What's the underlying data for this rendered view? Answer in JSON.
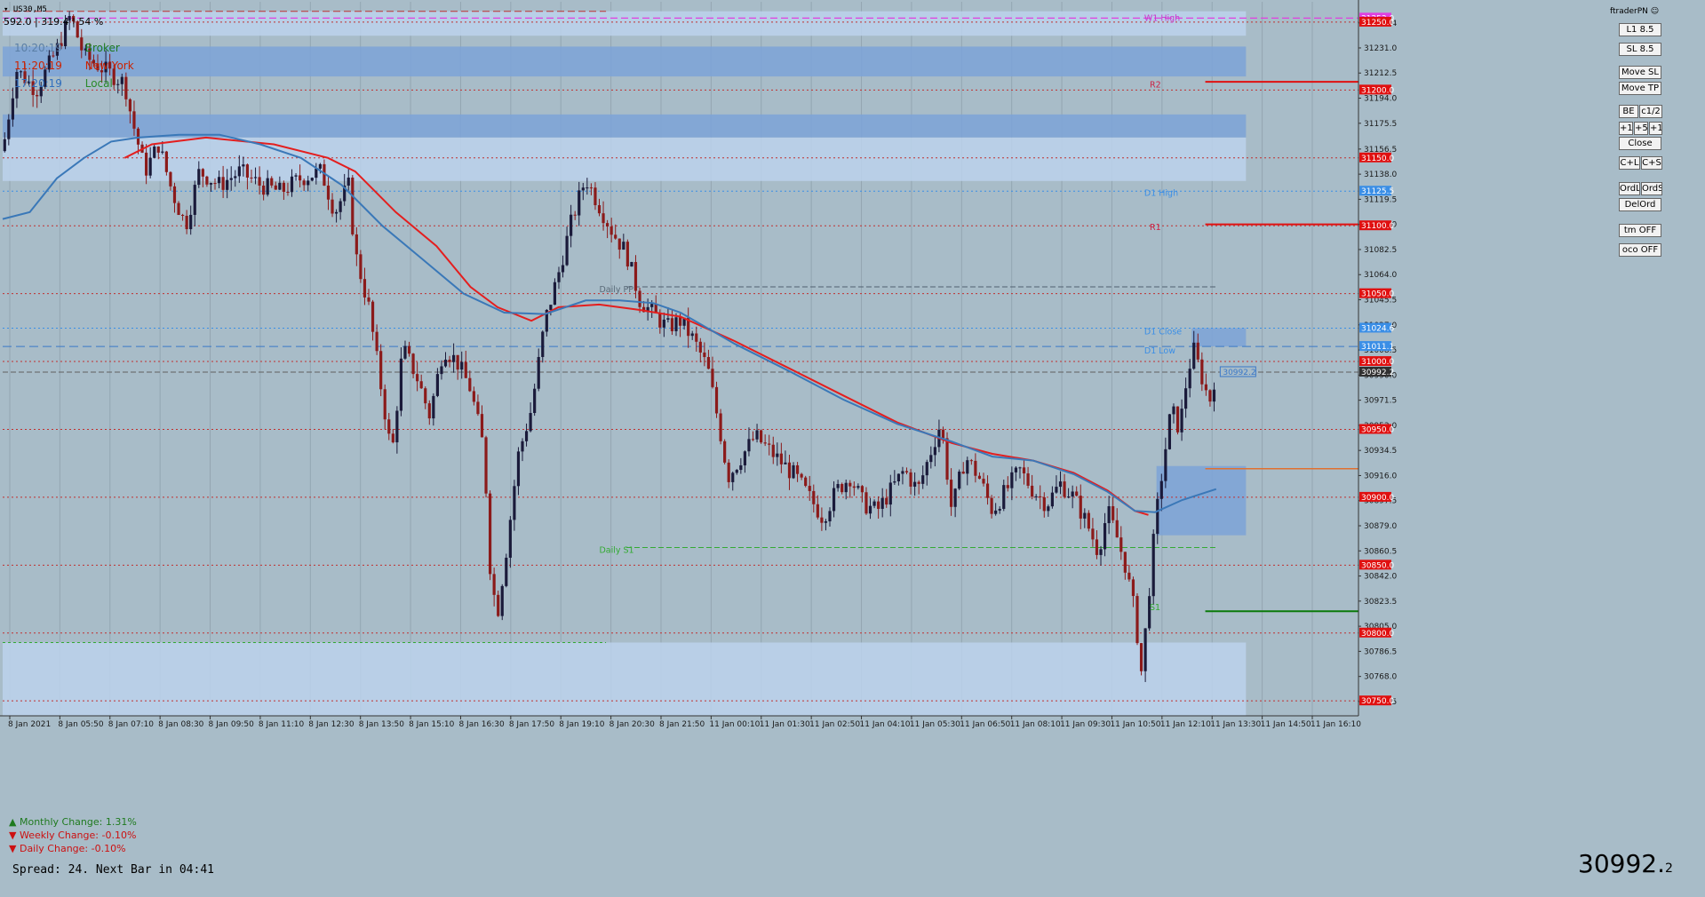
{
  "header": {
    "symbol": "US30,M5",
    "stats": "592.0 | 319.4 | 54 %",
    "brand": "ftraderPN"
  },
  "clocks": [
    {
      "time": "10:20:19",
      "label": "Broker",
      "time_color": "#5b7fa6",
      "label_color": "#1f7a1f"
    },
    {
      "time": "11:20:19",
      "label": "New York",
      "time_color": "#cc2200",
      "label_color": "#cc2200"
    },
    {
      "time": "17:20:19",
      "label": "Local",
      "time_color": "#2f6fbf",
      "label_color": "#2a8a2a"
    }
  ],
  "buttons": {
    "l1": "L1 8.5",
    "sl": "SL 8.5",
    "move_sl": "Move SL",
    "move_tp": "Move TP",
    "be": "BE",
    "c12": "c1/2",
    "plus1": "+1",
    "plus5": "+5",
    "plus10": "+10",
    "close": "Close",
    "cl": "C+L",
    "cs": "C+S",
    "ordl": "OrdL",
    "ords": "OrdS",
    "delord": "DelOrd",
    "tm": "tm OFF",
    "oco": "oco OFF"
  },
  "changes": {
    "monthly": "Monthly Change: 1.31%",
    "weekly": "Weekly Change: -0.10%",
    "daily": "Daily Change: -0.10%"
  },
  "info": {
    "spread": "Spread: 24. Next Bar in 04:41",
    "price_big": "30992.",
    "price_small": "2",
    "current_label": "30992.2"
  },
  "levels": [
    {
      "label": "W1 High",
      "color": "#cc33cc"
    },
    {
      "label": "R2",
      "color": "#cc2244"
    },
    {
      "label": "D1 High",
      "color": "#3a8ee6"
    },
    {
      "label": "R1",
      "color": "#cc2244"
    },
    {
      "label": "Daily PP",
      "color": "#5a6a78"
    },
    {
      "label": "D1 Close",
      "color": "#3a8ee6"
    },
    {
      "label": "D1 Low",
      "color": "#3a8ee6"
    },
    {
      "label": "Daily S1",
      "color": "#33aa33"
    },
    {
      "label": "S1",
      "color": "#33aa33"
    }
  ],
  "colors": {
    "background": "#a8bcc8",
    "bull_candle": "#1a1a3a",
    "bear_candle": "#8b1a1a",
    "ma_slow": "#e41e1e",
    "ma_fast": "#3a78b8",
    "zone_dark": "#7ea4d6",
    "zone_light": "#bcd2ec",
    "resistance": "#e01010",
    "support": "#0a7a0a"
  },
  "chart_data": {
    "type": "candlestick",
    "symbol": "US30",
    "timeframe": "M5",
    "ylim": [
      30739,
      31265
    ],
    "y_ticks": [
      31268.0,
      31249.4,
      31231.0,
      31212.5,
      31194.0,
      31175.5,
      31156.5,
      31138.0,
      31119.5,
      31101.0,
      31082.5,
      31064.0,
      31045.5,
      31027.0,
      31008.5,
      30990.0,
      30971.5,
      30953.0,
      30934.5,
      30916.0,
      30897.5,
      30879.0,
      30860.5,
      30842.0,
      30823.5,
      30805.0,
      30786.5,
      30768.0,
      30749.5
    ],
    "x_ticks": [
      "8 Jan 2021",
      "8 Jan 05:50",
      "8 Jan 07:10",
      "8 Jan 08:30",
      "8 Jan 09:50",
      "8 Jan 11:10",
      "8 Jan 12:30",
      "8 Jan 13:50",
      "8 Jan 15:10",
      "8 Jan 16:30",
      "8 Jan 17:50",
      "8 Jan 19:10",
      "8 Jan 20:30",
      "8 Jan 21:50",
      "11 Jan 00:10",
      "11 Jan 01:30",
      "11 Jan 02:50",
      "11 Jan 04:10",
      "11 Jan 05:30",
      "11 Jan 06:50",
      "11 Jan 08:10",
      "11 Jan 09:30",
      "11 Jan 10:50",
      "11 Jan 12:10",
      "11 Jan 13:30",
      "11 Jan 14:50",
      "11 Jan 16:10"
    ],
    "price_labels": [
      {
        "value": 31253.0,
        "text": "31253.0",
        "bg": "#e040e0"
      },
      {
        "value": 31250.0,
        "text": "31250.0",
        "bg": "#e01010"
      },
      {
        "value": 31200.0,
        "text": "31200.0",
        "bg": "#e01010"
      },
      {
        "value": 31150.0,
        "text": "31150.0",
        "bg": "#e01010"
      },
      {
        "value": 31125.5,
        "text": "31125.5",
        "bg": "#3a8ee6"
      },
      {
        "value": 31100.0,
        "text": "31100.0",
        "bg": "#e01010"
      },
      {
        "value": 31050.0,
        "text": "31050.0",
        "bg": "#e01010"
      },
      {
        "value": 31024.6,
        "text": "31024.6",
        "bg": "#3a8ee6"
      },
      {
        "value": 31011.1,
        "text": "31011.1",
        "bg": "#3a8ee6"
      },
      {
        "value": 31000.0,
        "text": "31000.0",
        "bg": "#e01010"
      },
      {
        "value": 30992.2,
        "text": "30992.2",
        "bg": "#303030"
      },
      {
        "value": 30950.0,
        "text": "30950.0",
        "bg": "#e01010"
      },
      {
        "value": 30900.0,
        "text": "30900.0",
        "bg": "#e01010"
      },
      {
        "value": 30850.0,
        "text": "30850.0",
        "bg": "#e01010"
      },
      {
        "value": 30800.0,
        "text": "30800.0",
        "bg": "#e01010"
      },
      {
        "value": 30750.0,
        "text": "30750.0",
        "bg": "#e01010"
      }
    ],
    "round_levels": [
      31250,
      31200,
      31150,
      31100,
      31050,
      31000,
      30950,
      30900,
      30850,
      30800,
      30750
    ],
    "zones": [
      {
        "y1": 31232,
        "y2": 31210,
        "x_end_frac": 0.917,
        "kind": "dark"
      },
      {
        "y1": 31182,
        "y2": 31165,
        "x_end_frac": 0.917,
        "kind": "dark"
      },
      {
        "y1": 31165,
        "y2": 31133,
        "x_end_frac": 0.917,
        "kind": "light"
      },
      {
        "y1": 31258,
        "y2": 31240,
        "x_end_frac": 0.917,
        "kind": "light"
      },
      {
        "y1": 30793,
        "y2": 30739,
        "x_end_frac": 0.917,
        "kind": "light"
      },
      {
        "y1": 31024.6,
        "y2": 31011.1,
        "x_start_frac": 0.877,
        "x_end_frac": 0.917,
        "kind": "dark"
      },
      {
        "y1": 30923,
        "y2": 30872,
        "x_start_frac": 0.851,
        "x_end_frac": 0.917,
        "kind": "dark"
      }
    ],
    "ohlc_path_points": [
      [
        0.0,
        31155
      ],
      [
        0.01,
        31215
      ],
      [
        0.025,
        31200
      ],
      [
        0.04,
        31230
      ],
      [
        0.05,
        31255
      ],
      [
        0.06,
        31225
      ],
      [
        0.075,
        31215
      ],
      [
        0.09,
        31205
      ],
      [
        0.095,
        31180
      ],
      [
        0.105,
        31140
      ],
      [
        0.115,
        31160
      ],
      [
        0.125,
        31125
      ],
      [
        0.135,
        31100
      ],
      [
        0.145,
        31140
      ],
      [
        0.16,
        31130
      ],
      [
        0.175,
        31140
      ],
      [
        0.19,
        31130
      ],
      [
        0.205,
        31125
      ],
      [
        0.22,
        31135
      ],
      [
        0.235,
        31140
      ],
      [
        0.245,
        31110
      ],
      [
        0.255,
        31130
      ],
      [
        0.26,
        31080
      ],
      [
        0.27,
        31040
      ],
      [
        0.28,
        30975
      ],
      [
        0.287,
        30930
      ],
      [
        0.295,
        31010
      ],
      [
        0.305,
        30990
      ],
      [
        0.315,
        30960
      ],
      [
        0.325,
        31010
      ],
      [
        0.335,
        31000
      ],
      [
        0.345,
        30980
      ],
      [
        0.355,
        30935
      ],
      [
        0.36,
        30840
      ],
      [
        0.365,
        30815
      ],
      [
        0.372,
        30865
      ],
      [
        0.38,
        30930
      ],
      [
        0.39,
        30965
      ],
      [
        0.4,
        31030
      ],
      [
        0.41,
        31065
      ],
      [
        0.42,
        31105
      ],
      [
        0.43,
        31135
      ],
      [
        0.44,
        31115
      ],
      [
        0.45,
        31095
      ],
      [
        0.46,
        31080
      ],
      [
        0.47,
        31045
      ],
      [
        0.48,
        31035
      ],
      [
        0.49,
        31025
      ],
      [
        0.5,
        31030
      ],
      [
        0.51,
        31015
      ],
      [
        0.52,
        30995
      ],
      [
        0.528,
        30955
      ],
      [
        0.535,
        30915
      ],
      [
        0.545,
        30930
      ],
      [
        0.555,
        30945
      ],
      [
        0.565,
        30935
      ],
      [
        0.575,
        30925
      ],
      [
        0.585,
        30915
      ],
      [
        0.595,
        30900
      ],
      [
        0.605,
        30885
      ],
      [
        0.615,
        30905
      ],
      [
        0.625,
        30915
      ],
      [
        0.635,
        30895
      ],
      [
        0.645,
        30890
      ],
      [
        0.655,
        30905
      ],
      [
        0.665,
        30920
      ],
      [
        0.675,
        30905
      ],
      [
        0.685,
        30935
      ],
      [
        0.692,
        30955
      ],
      [
        0.7,
        30890
      ],
      [
        0.71,
        30930
      ],
      [
        0.72,
        30915
      ],
      [
        0.73,
        30890
      ],
      [
        0.74,
        30905
      ],
      [
        0.75,
        30920
      ],
      [
        0.76,
        30905
      ],
      [
        0.77,
        30895
      ],
      [
        0.78,
        30910
      ],
      [
        0.79,
        30900
      ],
      [
        0.8,
        30880
      ],
      [
        0.808,
        30860
      ],
      [
        0.815,
        30890
      ],
      [
        0.822,
        30870
      ],
      [
        0.828,
        30850
      ],
      [
        0.835,
        30815
      ],
      [
        0.84,
        30770
      ],
      [
        0.845,
        30825
      ],
      [
        0.85,
        30880
      ],
      [
        0.856,
        30925
      ],
      [
        0.862,
        30965
      ],
      [
        0.868,
        30950
      ],
      [
        0.873,
        30985
      ],
      [
        0.878,
        31010
      ],
      [
        0.884,
        30990
      ],
      [
        0.89,
        30970
      ],
      [
        0.895,
        30993
      ]
    ],
    "ma_slow": [
      [
        0.09,
        31150
      ],
      [
        0.11,
        31160
      ],
      [
        0.15,
        31165
      ],
      [
        0.2,
        31160
      ],
      [
        0.24,
        31150
      ],
      [
        0.26,
        31140
      ],
      [
        0.29,
        31110
      ],
      [
        0.32,
        31085
      ],
      [
        0.345,
        31055
      ],
      [
        0.365,
        31040
      ],
      [
        0.39,
        31030
      ],
      [
        0.41,
        31040
      ],
      [
        0.44,
        31042
      ],
      [
        0.47,
        31038
      ],
      [
        0.5,
        31033
      ],
      [
        0.54,
        31015
      ],
      [
        0.58,
        30995
      ],
      [
        0.62,
        30975
      ],
      [
        0.66,
        30955
      ],
      [
        0.7,
        30940
      ],
      [
        0.73,
        30932
      ],
      [
        0.76,
        30927
      ],
      [
        0.79,
        30918
      ],
      [
        0.815,
        30905
      ],
      [
        0.835,
        30890
      ],
      [
        0.845,
        30887
      ]
    ],
    "ma_fast": [
      [
        0.0,
        31105
      ],
      [
        0.02,
        31110
      ],
      [
        0.04,
        31135
      ],
      [
        0.06,
        31150
      ],
      [
        0.08,
        31162
      ],
      [
        0.1,
        31165
      ],
      [
        0.13,
        31167
      ],
      [
        0.16,
        31167
      ],
      [
        0.19,
        31160
      ],
      [
        0.22,
        31150
      ],
      [
        0.25,
        31130
      ],
      [
        0.28,
        31100
      ],
      [
        0.31,
        31075
      ],
      [
        0.34,
        31050
      ],
      [
        0.37,
        31036
      ],
      [
        0.4,
        31035
      ],
      [
        0.43,
        31045
      ],
      [
        0.455,
        31045
      ],
      [
        0.48,
        31043
      ],
      [
        0.5,
        31036
      ],
      [
        0.54,
        31013
      ],
      [
        0.58,
        30993
      ],
      [
        0.62,
        30972
      ],
      [
        0.66,
        30954
      ],
      [
        0.7,
        30941
      ],
      [
        0.73,
        30930
      ],
      [
        0.76,
        30927
      ],
      [
        0.79,
        30917
      ],
      [
        0.815,
        30904
      ],
      [
        0.835,
        30890
      ],
      [
        0.85,
        30889
      ],
      [
        0.87,
        30898
      ],
      [
        0.895,
        30906
      ]
    ]
  }
}
